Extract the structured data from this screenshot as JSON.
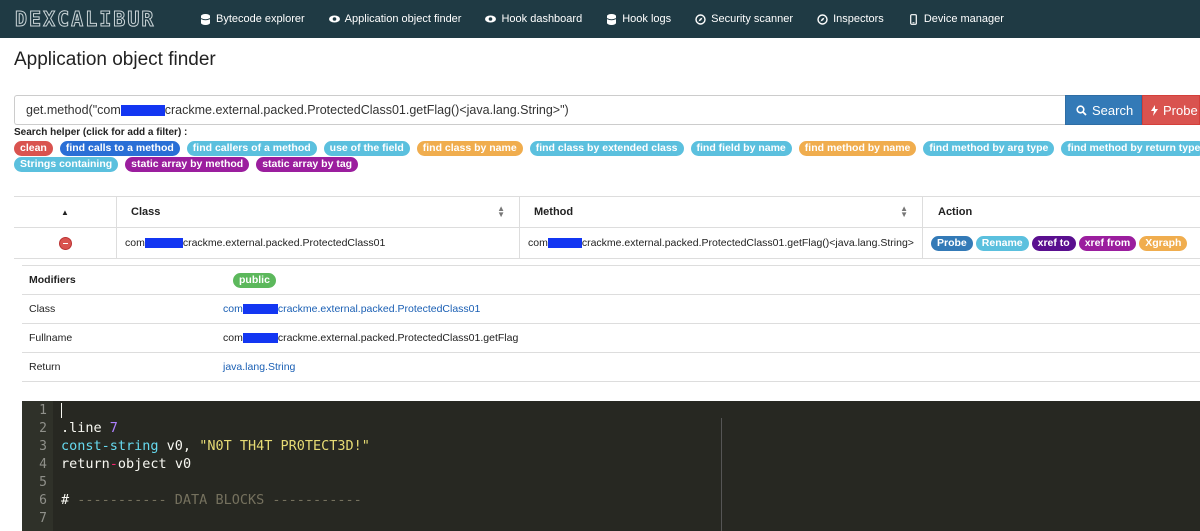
{
  "app": {
    "logo": "DEXCALIBUR"
  },
  "nav": [
    {
      "label": "Bytecode explorer",
      "icon": "database-icon"
    },
    {
      "label": "Application object finder",
      "icon": "eye-icon"
    },
    {
      "label": "Hook dashboard",
      "icon": "eye-icon"
    },
    {
      "label": "Hook logs",
      "icon": "database-icon"
    },
    {
      "label": "Security scanner",
      "icon": "compass-icon"
    },
    {
      "label": "Inspectors",
      "icon": "compass-icon"
    },
    {
      "label": "Device manager",
      "icon": "mobile-icon"
    }
  ],
  "page": {
    "title": "Application object finder"
  },
  "search": {
    "query_prefix": "get.method(\"com",
    "query_suffix": "crackme.external.packed.ProtectedClass01.getFlag()<java.lang.String>\")",
    "search_button": "Search",
    "probe_button": "Probe",
    "helper_title": "Search helper (click for add a filter) :"
  },
  "helpers_row1": [
    {
      "label": "clean",
      "color": "red"
    },
    {
      "label": "find calls to a method",
      "color": "darkblue"
    },
    {
      "label": "find callers of a method",
      "color": "cyan"
    },
    {
      "label": "use of the field",
      "color": "cyan"
    },
    {
      "label": "find class by name",
      "color": "orange"
    },
    {
      "label": "find class by extended class",
      "color": "cyan"
    },
    {
      "label": "find field by name",
      "color": "cyan"
    },
    {
      "label": "find method by name",
      "color": "orange"
    },
    {
      "label": "find method by arg type",
      "color": "cyan"
    },
    {
      "label": "find method by return type",
      "color": "cyan"
    }
  ],
  "helpers_row2": [
    {
      "label": "Strings containing",
      "color": "cyan"
    },
    {
      "label": "static array by method",
      "color": "purple"
    },
    {
      "label": "static array by tag",
      "color": "purple"
    }
  ],
  "table": {
    "headers": {
      "class": "Class",
      "method": "Method",
      "action": "Action"
    },
    "row": {
      "class_prefix": "com",
      "class_suffix": "crackme.external.packed.ProtectedClass01",
      "method_prefix": "com",
      "method_suffix": "crackme.external.packed.ProtectedClass01.getFlag()<java.lang.String>",
      "actions": [
        {
          "label": "Probe",
          "color": "#337ab7"
        },
        {
          "label": "Rename",
          "color": "#5bc0de"
        },
        {
          "label": "xref to",
          "color": "#5a0f8f"
        },
        {
          "label": "xref from",
          "color": "#9b1e9e"
        },
        {
          "label": "Xgraph",
          "color": "#f0ad4e"
        }
      ]
    }
  },
  "details": {
    "modifiers_label": "Modifiers",
    "modifiers_value": "public",
    "class_label": "Class",
    "class_prefix": "com",
    "class_suffix": "crackme.external.packed.ProtectedClass01",
    "fullname_label": "Fullname",
    "fullname_prefix": "com",
    "fullname_suffix": "crackme.external.packed.ProtectedClass01.getFlag",
    "return_label": "Return",
    "return_value": "java.lang.String"
  },
  "code": {
    "line_numbers": [
      "1",
      "2",
      "3",
      "4",
      "5",
      "6",
      "7"
    ],
    "line2_kw": ".line",
    "line2_num": "7",
    "line3_kw": "const-string",
    "line3_reg": " v0, ",
    "line3_str": "\"N0T TH4T PR0TECT3D!\"",
    "line4_a": "return",
    "line4_op": "-",
    "line4_b": "object v0",
    "line6_hash": "#",
    "line6_comment": " ----------- DATA BLOCKS -----------"
  }
}
